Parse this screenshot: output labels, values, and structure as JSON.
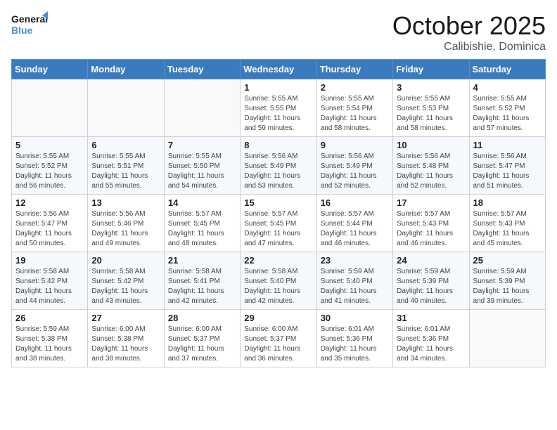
{
  "logo": {
    "line1": "General",
    "line2": "Blue"
  },
  "title": "October 2025",
  "location": "Calibishie, Dominica",
  "weekdays": [
    "Sunday",
    "Monday",
    "Tuesday",
    "Wednesday",
    "Thursday",
    "Friday",
    "Saturday"
  ],
  "weeks": [
    [
      {
        "day": "",
        "info": ""
      },
      {
        "day": "",
        "info": ""
      },
      {
        "day": "",
        "info": ""
      },
      {
        "day": "1",
        "info": "Sunrise: 5:55 AM\nSunset: 5:55 PM\nDaylight: 11 hours\nand 59 minutes."
      },
      {
        "day": "2",
        "info": "Sunrise: 5:55 AM\nSunset: 5:54 PM\nDaylight: 11 hours\nand 58 minutes."
      },
      {
        "day": "3",
        "info": "Sunrise: 5:55 AM\nSunset: 5:53 PM\nDaylight: 11 hours\nand 58 minutes."
      },
      {
        "day": "4",
        "info": "Sunrise: 5:55 AM\nSunset: 5:52 PM\nDaylight: 11 hours\nand 57 minutes."
      }
    ],
    [
      {
        "day": "5",
        "info": "Sunrise: 5:55 AM\nSunset: 5:52 PM\nDaylight: 11 hours\nand 56 minutes."
      },
      {
        "day": "6",
        "info": "Sunrise: 5:55 AM\nSunset: 5:51 PM\nDaylight: 11 hours\nand 55 minutes."
      },
      {
        "day": "7",
        "info": "Sunrise: 5:55 AM\nSunset: 5:50 PM\nDaylight: 11 hours\nand 54 minutes."
      },
      {
        "day": "8",
        "info": "Sunrise: 5:56 AM\nSunset: 5:49 PM\nDaylight: 11 hours\nand 53 minutes."
      },
      {
        "day": "9",
        "info": "Sunrise: 5:56 AM\nSunset: 5:49 PM\nDaylight: 11 hours\nand 52 minutes."
      },
      {
        "day": "10",
        "info": "Sunrise: 5:56 AM\nSunset: 5:48 PM\nDaylight: 11 hours\nand 52 minutes."
      },
      {
        "day": "11",
        "info": "Sunrise: 5:56 AM\nSunset: 5:47 PM\nDaylight: 11 hours\nand 51 minutes."
      }
    ],
    [
      {
        "day": "12",
        "info": "Sunrise: 5:56 AM\nSunset: 5:47 PM\nDaylight: 11 hours\nand 50 minutes."
      },
      {
        "day": "13",
        "info": "Sunrise: 5:56 AM\nSunset: 5:46 PM\nDaylight: 11 hours\nand 49 minutes."
      },
      {
        "day": "14",
        "info": "Sunrise: 5:57 AM\nSunset: 5:45 PM\nDaylight: 11 hours\nand 48 minutes."
      },
      {
        "day": "15",
        "info": "Sunrise: 5:57 AM\nSunset: 5:45 PM\nDaylight: 11 hours\nand 47 minutes."
      },
      {
        "day": "16",
        "info": "Sunrise: 5:57 AM\nSunset: 5:44 PM\nDaylight: 11 hours\nand 46 minutes."
      },
      {
        "day": "17",
        "info": "Sunrise: 5:57 AM\nSunset: 5:43 PM\nDaylight: 11 hours\nand 46 minutes."
      },
      {
        "day": "18",
        "info": "Sunrise: 5:57 AM\nSunset: 5:43 PM\nDaylight: 11 hours\nand 45 minutes."
      }
    ],
    [
      {
        "day": "19",
        "info": "Sunrise: 5:58 AM\nSunset: 5:42 PM\nDaylight: 11 hours\nand 44 minutes."
      },
      {
        "day": "20",
        "info": "Sunrise: 5:58 AM\nSunset: 5:42 PM\nDaylight: 11 hours\nand 43 minutes."
      },
      {
        "day": "21",
        "info": "Sunrise: 5:58 AM\nSunset: 5:41 PM\nDaylight: 11 hours\nand 42 minutes."
      },
      {
        "day": "22",
        "info": "Sunrise: 5:58 AM\nSunset: 5:40 PM\nDaylight: 11 hours\nand 42 minutes."
      },
      {
        "day": "23",
        "info": "Sunrise: 5:59 AM\nSunset: 5:40 PM\nDaylight: 11 hours\nand 41 minutes."
      },
      {
        "day": "24",
        "info": "Sunrise: 5:59 AM\nSunset: 5:39 PM\nDaylight: 11 hours\nand 40 minutes."
      },
      {
        "day": "25",
        "info": "Sunrise: 5:59 AM\nSunset: 5:39 PM\nDaylight: 11 hours\nand 39 minutes."
      }
    ],
    [
      {
        "day": "26",
        "info": "Sunrise: 5:59 AM\nSunset: 5:38 PM\nDaylight: 11 hours\nand 38 minutes."
      },
      {
        "day": "27",
        "info": "Sunrise: 6:00 AM\nSunset: 5:38 PM\nDaylight: 11 hours\nand 38 minutes."
      },
      {
        "day": "28",
        "info": "Sunrise: 6:00 AM\nSunset: 5:37 PM\nDaylight: 11 hours\nand 37 minutes."
      },
      {
        "day": "29",
        "info": "Sunrise: 6:00 AM\nSunset: 5:37 PM\nDaylight: 11 hours\nand 36 minutes."
      },
      {
        "day": "30",
        "info": "Sunrise: 6:01 AM\nSunset: 5:36 PM\nDaylight: 11 hours\nand 35 minutes."
      },
      {
        "day": "31",
        "info": "Sunrise: 6:01 AM\nSunset: 5:36 PM\nDaylight: 11 hours\nand 34 minutes."
      },
      {
        "day": "",
        "info": ""
      }
    ]
  ]
}
